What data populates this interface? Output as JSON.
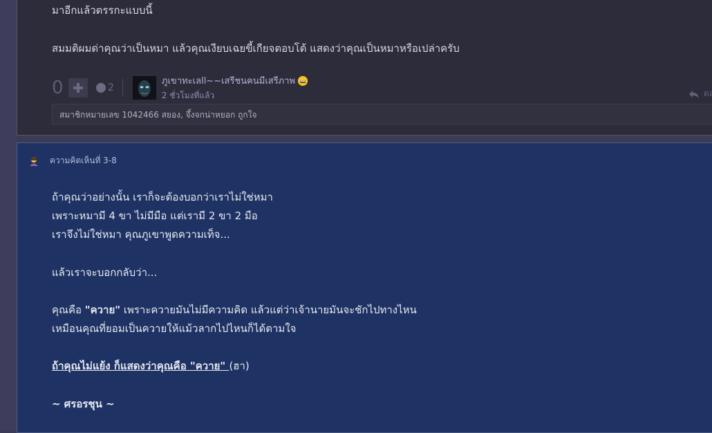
{
  "comment_1": {
    "lines": [
      "มาอีกแล้วตรรกะแบบนี้",
      "สมมติผมด่าคุณว่าเป็นหมา แล้วคุณเงียบเฉยขี้เกียจตอบโต้  แสดงว่าคุณเป็นหมาหรือเปล่าครับ"
    ],
    "vote_count": "0",
    "emotion_count": "2",
    "username": "ภูเขาทะเลll~~เสรีชนคนมีเสรีภาพ",
    "time": "2 ชั่วโมงที่แล้ว",
    "reply_label": "ตอ",
    "members_liked": "สมาชิกหมายเลข 1042466 สยอง, จึ้งจกน่าหยอก ถูกใจ"
  },
  "comment_2": {
    "title": "ความคิดเห็นที่ 3-8",
    "line_1": "ถ้าคุณว่าอย่างนั้น เราก็จะต้องบอกว่าเราไม่ใช่หมา",
    "line_2": "เพราะหมามี 4 ขา ไม่มีมือ แต่เรามี 2 ขา 2 มือ",
    "line_3": "เราจึงไม่ใช่หมา คุณภูเขาพูดความเท็จ...",
    "line_4": "แล้วเราจะบอกกลับว่า...",
    "line_5_a": "คุณคือ ",
    "line_5_b": "\"ควาย\"",
    "line_5_c": " เพราะควายมันไม่มีความคิด แล้วแต่ว่าเจ้านายมันจะชักไปทางไหน",
    "line_6": "เหมือนคุณที่ยอมเป็นควายให้แม้วลากไปไหนก็ได้ตามใจ",
    "line_7_a": "ถ้าคุณไม่แย้ง ก็แสดงว่าคุณคือ \"ควาย\" ",
    "line_7_b": "(ฮา)",
    "signature": "~ ศรอรชุน ~"
  },
  "colors": {
    "card1_bg": "#2d2c3a",
    "card2_bg": "#1e3363",
    "username": "#b6b3d6"
  },
  "icons": [
    "plus-icon",
    "emotion-icon",
    "smiley-icon",
    "reply-icon",
    "user-icon"
  ]
}
